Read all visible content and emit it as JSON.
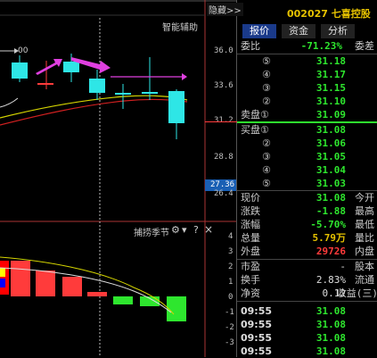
{
  "header": {
    "hide_label": "隐藏>>",
    "stock_code": "002027",
    "stock_name": "七喜控股"
  },
  "chart": {
    "assist_label": "智能辅助",
    "price_ticks": [
      "36.0",
      "33.6",
      "31.2",
      "28.8",
      "26.4"
    ],
    "current_price_tag": "27.36",
    "indicator_label": "捕捞季节",
    "indicator_ticks": [
      "4",
      "3",
      "2",
      "1",
      "0",
      "-1",
      "-2",
      "-3"
    ],
    "indicator_icons": [
      "gear-icon",
      "arrow-down-icon",
      "help-icon",
      "close-icon"
    ],
    "indicator_symbols": [
      "⚙",
      "▾",
      "?",
      "×"
    ],
    "candle_label_00": "00",
    "colors": {
      "up": "#ff3b3b",
      "down": "#2ee6e6",
      "fall": "#2ee62e",
      "arrow": "#e040e0",
      "ma_yellow": "#d4d400",
      "ma_red": "#d02020"
    }
  },
  "tabs": [
    "报价",
    "资金",
    "分析"
  ],
  "order_book": {
    "wei_bi_label": "委比",
    "wei_bi_value": "-71.23%",
    "wei_cha_label": "委差",
    "asks": [
      {
        "level": "⑤",
        "price": "31.18"
      },
      {
        "level": "④",
        "price": "31.17"
      },
      {
        "level": "③",
        "price": "31.15"
      },
      {
        "level": "②",
        "price": "31.10"
      },
      {
        "level": "卖盘①",
        "price": "31.09"
      }
    ],
    "bids": [
      {
        "level": "买盘①",
        "price": "31.08"
      },
      {
        "level": "②",
        "price": "31.06"
      },
      {
        "level": "③",
        "price": "31.05"
      },
      {
        "level": "④",
        "price": "31.04"
      },
      {
        "level": "⑤",
        "price": "31.03"
      }
    ]
  },
  "quote": [
    {
      "label": "现价",
      "value": "31.08",
      "color": "green",
      "label2": "今开"
    },
    {
      "label": "涨跌",
      "value": "-1.88",
      "color": "green",
      "label2": "最高"
    },
    {
      "label": "涨幅",
      "value": "-5.70%",
      "color": "green",
      "label2": "最低"
    },
    {
      "label": "总量",
      "value": "5.79万",
      "color": "yellow",
      "label2": "量比"
    },
    {
      "label": "外盘",
      "value": "29726",
      "color": "red",
      "label2": "内盘"
    }
  ],
  "stats": [
    {
      "label": "市盈",
      "value": "-",
      "label2": "股本"
    },
    {
      "label": "换手",
      "value": "2.83%",
      "label2": "流通"
    },
    {
      "label": "净资",
      "value": "0.12",
      "label2": "收益(三)"
    }
  ],
  "ticks": [
    {
      "time": "09:55",
      "price": "31.08"
    },
    {
      "time": "09:55",
      "price": "31.08"
    },
    {
      "time": "09:55",
      "price": "31.08"
    },
    {
      "time": "09:55",
      "price": "31.08"
    }
  ]
}
